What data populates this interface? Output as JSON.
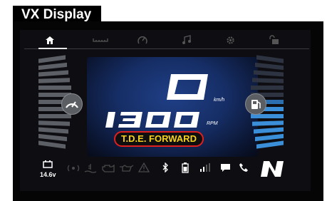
{
  "window": {
    "title": "VX Display"
  },
  "nav": {
    "tabs": [
      {
        "name": "home",
        "icon": "home-icon",
        "active": true
      },
      {
        "name": "ruler",
        "icon": "ruler-icon",
        "active": false
      },
      {
        "name": "gauge",
        "icon": "gauge-icon",
        "active": false
      },
      {
        "name": "music",
        "icon": "music-icon",
        "active": false
      },
      {
        "name": "settings",
        "icon": "gear-icon",
        "active": false
      },
      {
        "name": "lock",
        "icon": "unlock-icon",
        "active": false
      }
    ]
  },
  "speed": {
    "value": "0",
    "unit": "km/h"
  },
  "rpm": {
    "value": "1300",
    "unit": "RPM"
  },
  "mode": {
    "label": "T.D.E. FORWARD"
  },
  "status": {
    "voltage": "14.6v",
    "gear": "N",
    "icons": [
      "battery-icon",
      "immobilizer-icon",
      "coolant-icon",
      "engine-icon",
      "oil-icon",
      "warning-icon",
      "bluetooth-icon",
      "phone-battery-icon",
      "signal-icon",
      "message-icon",
      "call-icon"
    ]
  },
  "colors": {
    "accent_blue": "#3a8fd8",
    "mode_text": "#f6d21c",
    "mode_border": "#e01f1f",
    "panel": "#1f3f86"
  }
}
